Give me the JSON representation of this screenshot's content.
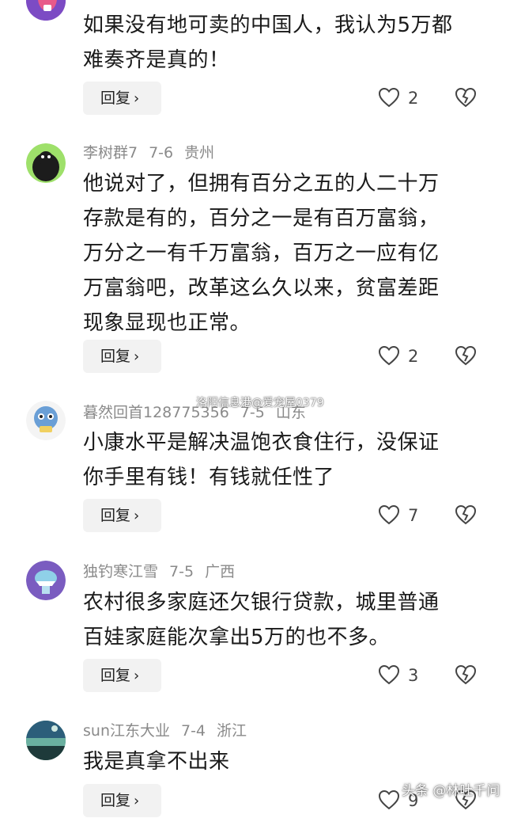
{
  "comments": [
    {
      "meta": {
        "user": "",
        "date": "",
        "region": ""
      },
      "lines": [
        "如果没有地可卖的中国人，我认为5万都",
        "难奏齐是真的！"
      ],
      "reply_label": "回复",
      "likes": "2"
    },
    {
      "meta": {
        "user": "李树群7",
        "date": "7-6",
        "region": "贵州"
      },
      "lines": [
        "他说对了，但拥有百分之五的人二十万",
        "存款是有的，百分之一是有百万富翁，",
        "万分之一有千万富翁，百万之一应有亿",
        "万富翁吧，改革这么久以来，贫富差距",
        "现象显现也正常。"
      ],
      "reply_label": "回复",
      "likes": "2"
    },
    {
      "meta": {
        "user": "暮然回首128775356",
        "date": "7-5",
        "region": "山东"
      },
      "lines": [
        "小康水平是解决温饱衣食住行，没保证",
        "你手里有钱！有钱就任性了"
      ],
      "reply_label": "回复",
      "likes": "7"
    },
    {
      "meta": {
        "user": "独钓寒江雪",
        "date": "7-5",
        "region": "广西"
      },
      "lines": [
        "农村很多家庭还欠银行贷款，城里普通",
        "百娃家庭能次拿出5万的也不多。"
      ],
      "reply_label": "回复",
      "likes": "3"
    },
    {
      "meta": {
        "user": "sun江东大业",
        "date": "7-4",
        "region": "浙江"
      },
      "lines": [
        "我是真拿不出来"
      ],
      "reply_label": "回复",
      "likes": "9"
    }
  ],
  "watermark": "洛阳信息港@爱宠屋0379",
  "brand": "头条 @林吐千问",
  "colors": {
    "meta": "#8a8a8a",
    "text": "#1a1a1a",
    "reply_bg": "#f2f2f2"
  },
  "icons": {
    "like": "heart-outline-icon",
    "dislike": "broken-heart-icon",
    "reply": "chevron-right-icon"
  }
}
